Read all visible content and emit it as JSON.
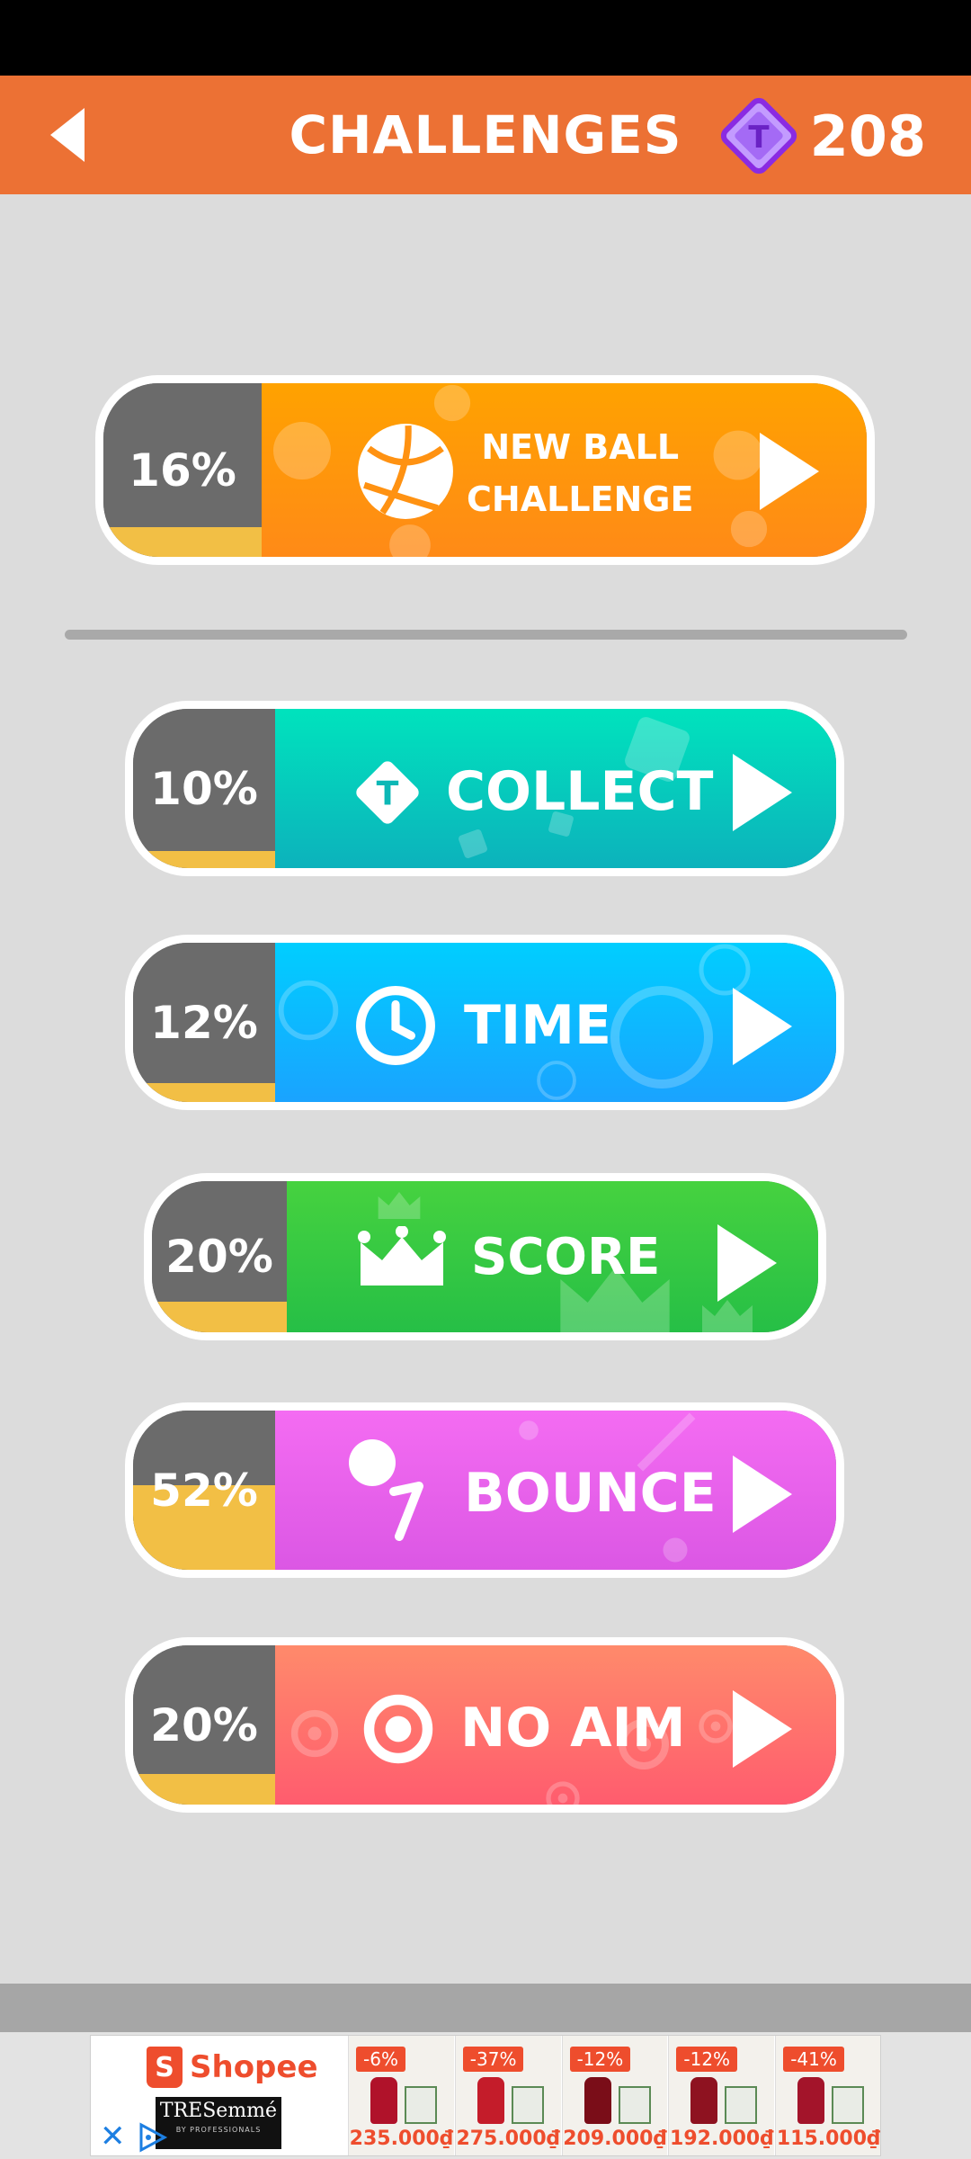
{
  "header": {
    "title": "CHALLENGES",
    "gem_symbol": "T",
    "gem_count": "208",
    "accent_color": "#ec7134"
  },
  "challenges": [
    {
      "name": "new-ball",
      "label_line1": "NEW BALL",
      "label_line2": "CHALLENGE",
      "progress": "16%",
      "progress_value": 0.16,
      "icon": "basketball-icon",
      "color_top": "#ffa200",
      "color_bottom": "#ff8a17"
    },
    {
      "name": "collect",
      "label": "COLLECT",
      "progress": "10%",
      "progress_value": 0.1,
      "icon": "gem-icon",
      "color_top": "#00e3bd",
      "color_bottom": "#0cb2bc"
    },
    {
      "name": "time",
      "label": "TIME",
      "progress": "12%",
      "progress_value": 0.12,
      "icon": "clock-icon",
      "color_top": "#00ceff",
      "color_bottom": "#1aa3ff"
    },
    {
      "name": "score",
      "label": "SCORE",
      "progress": "20%",
      "progress_value": 0.2,
      "icon": "crown-icon",
      "color_top": "#46d23f",
      "color_bottom": "#26bf46"
    },
    {
      "name": "bounce",
      "label": "BOUNCE",
      "progress": "52%",
      "progress_value": 0.52,
      "icon": "bounce-icon",
      "color_top": "#f46cf2",
      "color_bottom": "#db57e4"
    },
    {
      "name": "no-aim",
      "label": "NO AIM",
      "progress": "20%",
      "progress_value": 0.2,
      "icon": "target-icon",
      "color_top": "#ff8a6b",
      "color_bottom": "#ff5c6e"
    }
  ],
  "ad": {
    "brand": "Shopee",
    "brand_bag_letter": "S",
    "sub_brand": "TRESemmé",
    "sub_brand_tagline": "BY PROFESSIONALS",
    "close_glyph": "✕",
    "products": [
      {
        "discount": "-6%",
        "price": "235.000₫",
        "bottle_color": "#b0122a"
      },
      {
        "discount": "-37%",
        "price": "275.000₫",
        "bottle_color": "#c41c2a"
      },
      {
        "discount": "-12%",
        "price": "209.000₫",
        "bottle_color": "#7a0d18"
      },
      {
        "discount": "-12%",
        "price": "192.000₫",
        "bottle_color": "#8e1220"
      },
      {
        "discount": "-41%",
        "price": "115.000₫",
        "bottle_color": "#a3142a"
      }
    ]
  }
}
